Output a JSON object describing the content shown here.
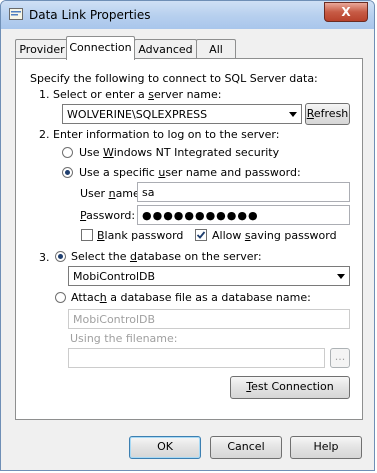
{
  "window": {
    "title": "Data Link Properties",
    "close_glyph": "X"
  },
  "tabs": [
    {
      "label": "Provider"
    },
    {
      "label": "Connection"
    },
    {
      "label": "Advanced"
    },
    {
      "label": "All"
    }
  ],
  "connection": {
    "intro": "Specify the following to connect to SQL Server data:",
    "step1": {
      "label_prefix": "1. Select or enter a ",
      "label_key": "s",
      "label_rest": "erver name:",
      "server_value": "WOLVERINE\\SQLEXPRESS",
      "refresh_key": "R",
      "refresh_rest": "efresh"
    },
    "step2": {
      "label": "2. Enter information to log on to the server:",
      "nt_prefix": "Use ",
      "nt_key": "W",
      "nt_rest": "indows NT Integrated security",
      "specific_prefix": "Use a specific ",
      "specific_key": "u",
      "specific_rest": "ser name and password:",
      "username_prefix": "User ",
      "username_key": "n",
      "username_rest": "ame:",
      "username_value": "sa",
      "password_key": "P",
      "password_rest": "assword:",
      "password_mask": "●●●●●●●●●●●",
      "blank_key": "B",
      "blank_rest": "lank password",
      "allow_prefix": "Allow ",
      "allow_key": "s",
      "allow_rest": "aving password",
      "selected_mode": "specific",
      "blank_checked": false,
      "allow_saving_checked": true
    },
    "step3": {
      "number": "3.",
      "select_prefix": "Select the ",
      "select_key": "d",
      "select_rest": "atabase on the server:",
      "database_value": "MobiControlDB",
      "attach_prefix": "Attac",
      "attach_key": "h",
      "attach_rest": " a database file as a database name:",
      "attach_value": "MobiControlDB",
      "filename_label": "Using the filename:",
      "browse_label": "...",
      "selected_mode": "select"
    },
    "test_key": "T",
    "test_rest": "est Connection"
  },
  "footer": {
    "ok": "OK",
    "cancel": "Cancel",
    "help": "Help"
  }
}
